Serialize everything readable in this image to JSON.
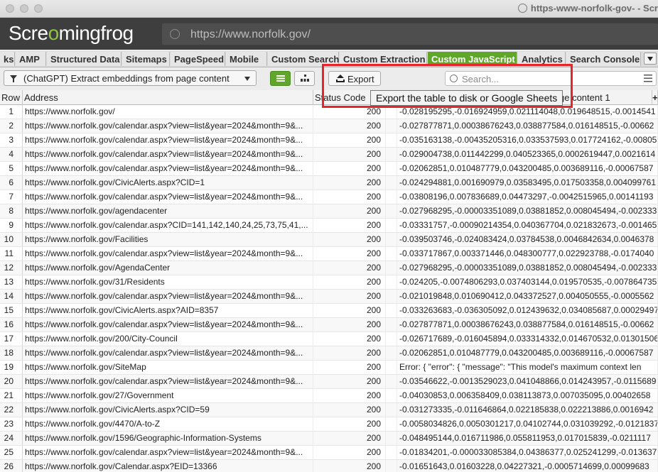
{
  "window": {
    "title": "https-www-norfolk-gov- - Scr"
  },
  "app": {
    "logo_main": "Scre",
    "logo_mid": "mingfrog",
    "logo_o": "o"
  },
  "urlbar": {
    "value": "https://www.norfolk.gov/"
  },
  "tabs": [
    {
      "label": "ks",
      "active": false
    },
    {
      "label": "AMP",
      "active": false
    },
    {
      "label": "Structured Data",
      "active": false
    },
    {
      "label": "Sitemaps",
      "active": false
    },
    {
      "label": "PageSpeed",
      "active": false
    },
    {
      "label": "Mobile",
      "active": false
    },
    {
      "label": "Custom Search",
      "active": false
    },
    {
      "label": "Custom Extraction",
      "active": false
    },
    {
      "label": "Custom JavaScript",
      "active": true
    },
    {
      "label": "Analytics",
      "active": false
    },
    {
      "label": "Search Console",
      "active": false
    }
  ],
  "toolbar": {
    "filter_label": "(ChatGPT) Extract embeddings from page content",
    "export_label": "Export",
    "search_placeholder": "Search..."
  },
  "tooltip": {
    "text": "Export the table to disk or Google Sheets"
  },
  "table": {
    "columns": {
      "row": "Row",
      "address": "Address",
      "status": "Status Code",
      "embeddings": "ge content 1",
      "add": "+"
    },
    "rows": [
      {
        "n": "1",
        "address": "https://www.norfolk.gov/",
        "status": "200",
        "emb": "-0.028195295,-0.016924959,0.021114048,0.019648515,-0.0014541"
      },
      {
        "n": "2",
        "address": "https://www.norfolk.gov/calendar.aspx?view=list&year=2024&month=9&...",
        "status": "200",
        "emb": "-0.027877871,0.00038676243,0.038877584,0.016148515,-0.00662"
      },
      {
        "n": "3",
        "address": "https://www.norfolk.gov/calendar.aspx?view=list&year=2024&month=9&...",
        "status": "200",
        "emb": "-0.035163138,-0.00435205316,0.033537593,0.017724162,-0.008056"
      },
      {
        "n": "4",
        "address": "https://www.norfolk.gov/calendar.aspx?view=list&year=2024&month=9&...",
        "status": "200",
        "emb": "-0.029004738,0.011442299,0.040523365,0.0002619447,0.0021614"
      },
      {
        "n": "5",
        "address": "https://www.norfolk.gov/calendar.aspx?view=list&year=2024&month=9&...",
        "status": "200",
        "emb": "-0.02062851,0.010487779,0.043200485,0.003689116,-0.00067587"
      },
      {
        "n": "6",
        "address": "https://www.norfolk.gov/CivicAlerts.aspx?CID=1",
        "status": "200",
        "emb": "-0.024294881,0.001690979,0.03583495,0.017503358,0.004099761"
      },
      {
        "n": "7",
        "address": "https://www.norfolk.gov/calendar.aspx?view=list&year=2024&month=9&...",
        "status": "200",
        "emb": "-0.03808196,0.007836689,0.04473297,-0.0042515965,0.00141193"
      },
      {
        "n": "8",
        "address": "https://www.norfolk.gov/agendacenter",
        "status": "200",
        "emb": "-0.027968295,-0.00003351089,0.03881852,0.008045494,-0.002333"
      },
      {
        "n": "9",
        "address": "https://www.norfolk.gov/calendar.aspx?CID=141,142,140,24,25,73,75,41,...",
        "status": "200",
        "emb": "-0.03331757,-0.00090214354,0.040367704,0.021832673,-0.001465"
      },
      {
        "n": "10",
        "address": "https://www.norfolk.gov/Facilities",
        "status": "200",
        "emb": "-0.039503746,-0.024083424,0.03784538,0.0046842634,0.0046378"
      },
      {
        "n": "11",
        "address": "https://www.norfolk.gov/calendar.aspx?view=list&year=2024&month=9&...",
        "status": "200",
        "emb": "-0.033717867,0.003371446,0.048300777,0.022923788,-0.0174040"
      },
      {
        "n": "12",
        "address": "https://www.norfolk.gov/AgendaCenter",
        "status": "200",
        "emb": "-0.027968295,-0.00003351089,0.03881852,0.008045494,-0.002333"
      },
      {
        "n": "13",
        "address": "https://www.norfolk.gov/31/Residents",
        "status": "200",
        "emb": "-0.024205,-0.0074806293,0.037403144,0.019570535,-0.007864735"
      },
      {
        "n": "14",
        "address": "https://www.norfolk.gov/calendar.aspx?view=list&year=2024&month=9&...",
        "status": "200",
        "emb": "-0.021019848,0.010690412,0.043372527,0.004050555,-0.0005562"
      },
      {
        "n": "15",
        "address": "https://www.norfolk.gov/CivicAlerts.aspx?AID=8357",
        "status": "200",
        "emb": "-0.033263683,-0.036305092,0.012439632,0.034085687,0.00029497"
      },
      {
        "n": "16",
        "address": "https://www.norfolk.gov/calendar.aspx?view=list&year=2024&month=9&...",
        "status": "200",
        "emb": "-0.027877871,0.00038676243,0.038877584,0.016148515,-0.00662"
      },
      {
        "n": "17",
        "address": "https://www.norfolk.gov/200/City-Council",
        "status": "200",
        "emb": "-0.026717689,-0.016045894,0.033314332,0.014670532,0.01301506"
      },
      {
        "n": "18",
        "address": "https://www.norfolk.gov/calendar.aspx?view=list&year=2024&month=9&...",
        "status": "200",
        "emb": "-0.02062851,0.010487779,0.043200485,0.003689116,-0.00067587"
      },
      {
        "n": "19",
        "address": "https://www.norfolk.gov/SiteMap",
        "status": "200",
        "emb": "Error: {   \"error\": {     \"message\": \"This model's maximum context len"
      },
      {
        "n": "20",
        "address": "https://www.norfolk.gov/calendar.aspx?view=list&year=2024&month=9&...",
        "status": "200",
        "emb": "-0.03546622,-0.0013529023,0.041048866,0.014243957,-0.0115689"
      },
      {
        "n": "21",
        "address": "https://www.norfolk.gov/27/Government",
        "status": "200",
        "emb": "-0.04030853,0.006358409,0.038113873,0.007035095,0.00402658"
      },
      {
        "n": "22",
        "address": "https://www.norfolk.gov/CivicAlerts.aspx?CID=59",
        "status": "200",
        "emb": "-0.031273335,-0.011646864,0.022185838,0.022213886,0.0016942"
      },
      {
        "n": "23",
        "address": "https://www.norfolk.gov/4470/A-to-Z",
        "status": "200",
        "emb": "-0.0058034826,0.0050301217,0.04102744,0.031039292,-0.0121837"
      },
      {
        "n": "24",
        "address": "https://www.norfolk.gov/1596/Geographic-Information-Systems",
        "status": "200",
        "emb": "-0.048495144,0.016711986,0.055811953,0.017015839,-0.0211117"
      },
      {
        "n": "25",
        "address": "https://www.norfolk.gov/calendar.aspx?view=list&year=2024&month=9&...",
        "status": "200",
        "emb": "-0.01834201,-0.000033085384,0.04386377,0.025241299,-0.013637"
      },
      {
        "n": "26",
        "address": "https://www.norfolk.gov/Calendar.aspx?EID=13366",
        "status": "200",
        "emb": "-0.01651643,0.01603228,0.04227321,-0.0005714699,0.00099683"
      }
    ]
  }
}
